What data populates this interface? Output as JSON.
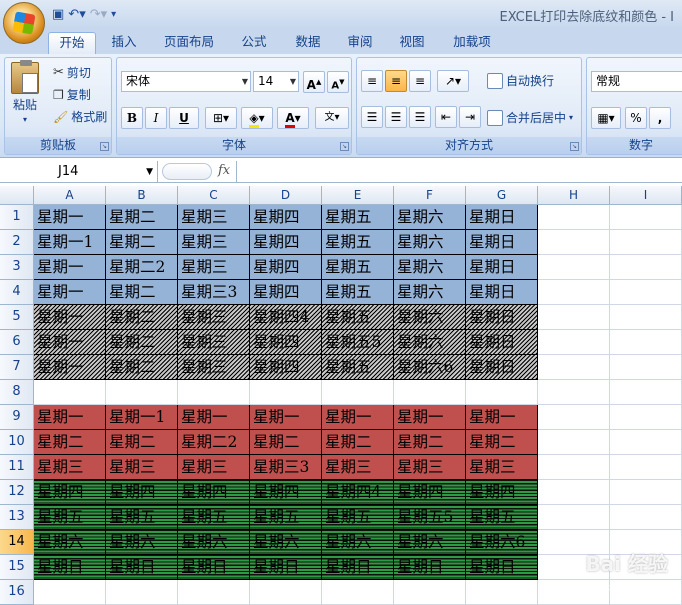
{
  "window": {
    "title": "EXCEL打印去除底纹和颜色 - I"
  },
  "tabs": [
    "开始",
    "插入",
    "页面布局",
    "公式",
    "数据",
    "审阅",
    "视图",
    "加载项"
  ],
  "ribbon": {
    "clipboard": {
      "label": "剪贴板",
      "paste": "粘贴",
      "cut": "剪切",
      "copy": "复制",
      "format_painter": "格式刷"
    },
    "font": {
      "label": "字体",
      "name": "宋体",
      "size": "14",
      "grow": "A",
      "shrink": "A",
      "bold": "B",
      "italic": "I",
      "underline": "U",
      "phonetic": "wén"
    },
    "alignment": {
      "label": "对齐方式",
      "wrap": "自动换行",
      "merge": "合并后居中"
    },
    "number": {
      "label": "数字",
      "format": "常规",
      "percent": "%",
      "comma": ","
    }
  },
  "formula_bar": {
    "name_box": "J14",
    "fx": "fx",
    "formula": ""
  },
  "grid": {
    "columns": [
      "A",
      "B",
      "C",
      "D",
      "E",
      "F",
      "G",
      "H",
      "I"
    ],
    "rows": [
      "1",
      "2",
      "3",
      "4",
      "5",
      "6",
      "7",
      "8",
      "9",
      "10",
      "11",
      "12",
      "13",
      "14",
      "15",
      "16"
    ],
    "selected_row": "14",
    "cells": [
      [
        "星期一",
        "星期二",
        "星期三",
        "星期四",
        "星期五",
        "星期六",
        "星期日"
      ],
      [
        "星期一1",
        "星期二",
        "星期三",
        "星期四",
        "星期五",
        "星期六",
        "星期日"
      ],
      [
        "星期一",
        "星期二2",
        "星期三",
        "星期四",
        "星期五",
        "星期六",
        "星期日"
      ],
      [
        "星期一",
        "星期二",
        "星期三3",
        "星期四",
        "星期五",
        "星期六",
        "星期日"
      ],
      [
        "星期一",
        "星期二",
        "星期三",
        "星期四4",
        "星期五",
        "星期六",
        "星期日"
      ],
      [
        "星期一",
        "星期二",
        "星期三",
        "星期四",
        "星期五5",
        "星期六",
        "星期日"
      ],
      [
        "星期一",
        "星期二",
        "星期三",
        "星期四",
        "星期五",
        "星期六6",
        "星期日"
      ],
      [
        "",
        "",
        "",
        "",
        "",
        "",
        ""
      ],
      [
        "星期一",
        "星期一1",
        "星期一",
        "星期一",
        "星期一",
        "星期一",
        "星期一"
      ],
      [
        "星期二",
        "星期二",
        "星期二2",
        "星期二",
        "星期二",
        "星期二",
        "星期二"
      ],
      [
        "星期三",
        "星期三",
        "星期三",
        "星期三3",
        "星期三",
        "星期三",
        "星期三"
      ],
      [
        "星期四",
        "星期四",
        "星期四",
        "星期四",
        "星期四4",
        "星期四",
        "星期四"
      ],
      [
        "星期五",
        "星期五",
        "星期五",
        "星期五",
        "星期五",
        "星期五5",
        "星期五"
      ],
      [
        "星期六",
        "星期六",
        "星期六",
        "星期六",
        "星期六",
        "星期六",
        "星期六6"
      ],
      [
        "星期日",
        "星期日",
        "星期日",
        "星期日",
        "星期日",
        "星期日",
        "星期日"
      ],
      [
        "",
        "",
        "",
        "",
        "",
        "",
        ""
      ]
    ],
    "row_styles": [
      "blue",
      "blue",
      "blue",
      "blue",
      "hatch",
      "hatch",
      "hatch",
      "none",
      "red",
      "red",
      "red",
      "green",
      "green",
      "green",
      "green",
      "none"
    ]
  },
  "colors": {
    "blue": "#95b3d7",
    "red": "#c0504d",
    "green": "#2f9a45",
    "hatch": "#c8c8c8"
  },
  "watermark": {
    "text": "Bai 经验",
    "sub": "jingyan.baidu.com"
  }
}
